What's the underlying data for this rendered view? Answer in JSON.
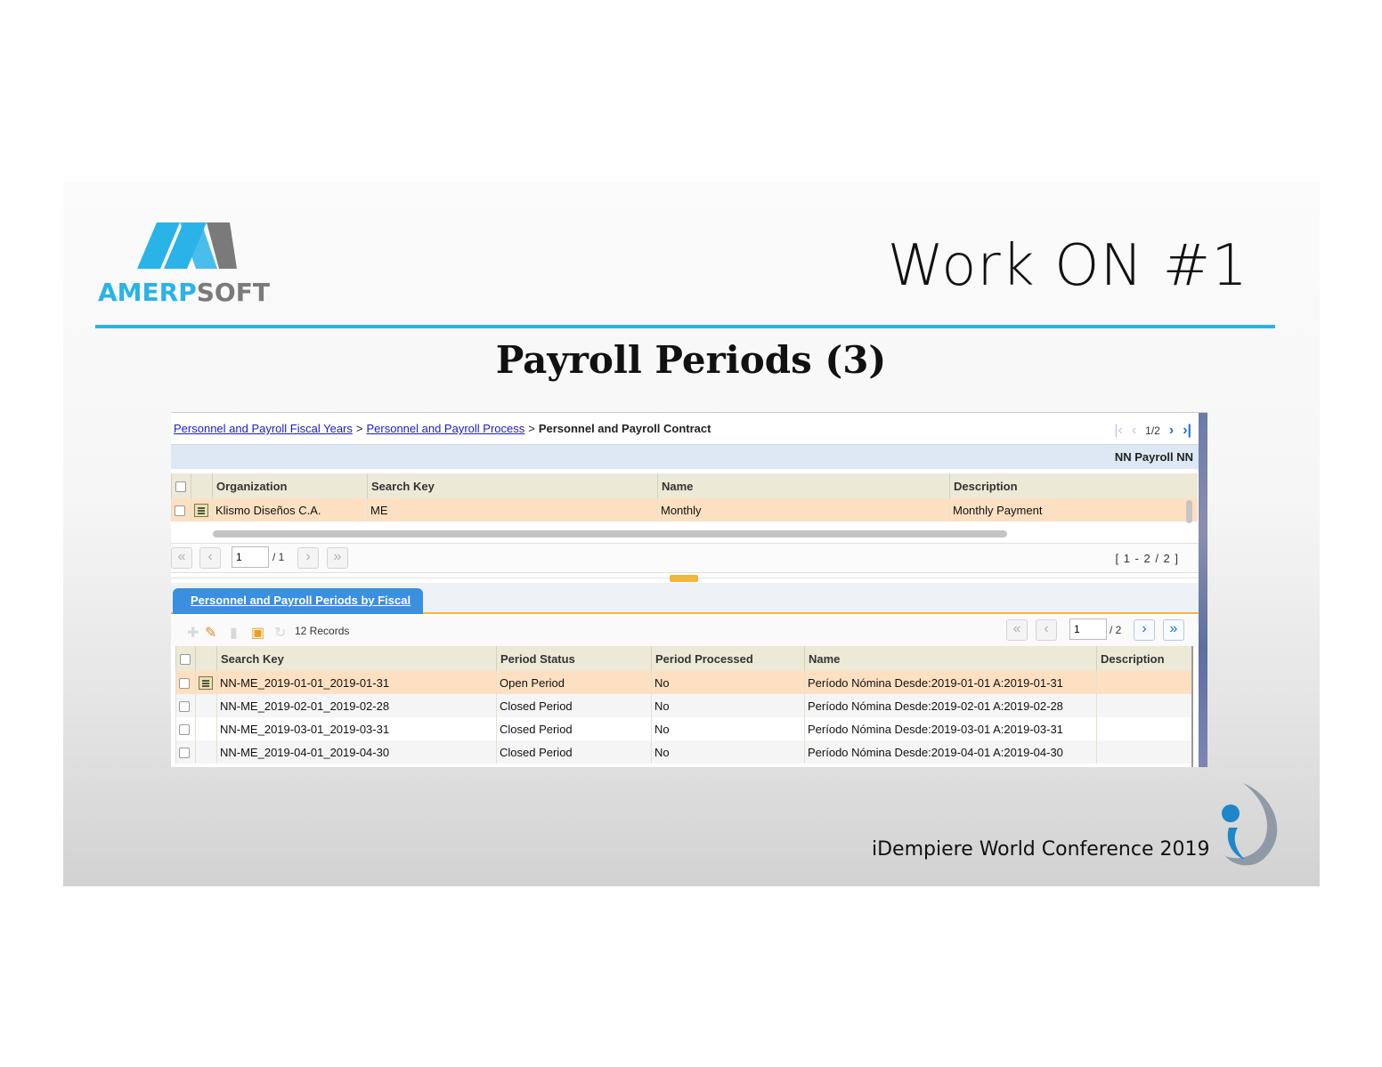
{
  "slide": {
    "title": "Work ON #1",
    "subtitle": "Payroll Periods (3)",
    "logo_text_a": "AMERP",
    "logo_text_b": "SOFT",
    "footer": "iDempiere World Conference 2019",
    "colors": {
      "accent": "#2ab3e6",
      "logo_gray": "#7a7a7a"
    }
  },
  "breadcrumb": {
    "link1": "Personnel and Payroll Fiscal Years",
    "link2": "Personnel and Payroll Process",
    "current": "Personnel and Payroll Contract",
    "sep": ">"
  },
  "record_nav": {
    "position": "1/2"
  },
  "header_band": {
    "label": "NN Payroll NN"
  },
  "parent_grid": {
    "columns": [
      "Organization",
      "Search Key",
      "Name",
      "Description"
    ],
    "rows": [
      [
        "Klismo Diseños C.A.",
        "ME",
        "Monthly",
        "Monthly Payment"
      ]
    ]
  },
  "parent_pager": {
    "page": "1",
    "total": "/ 1",
    "range": "[ 1 - 2 / 2 ]"
  },
  "tab": {
    "label": "Personnel and Payroll Periods by Fiscal"
  },
  "toolbar": {
    "records": "12 Records"
  },
  "child_pager": {
    "page": "1",
    "total": "/ 2"
  },
  "child_grid": {
    "columns": [
      "Search Key",
      "Period Status",
      "Period Processed",
      "Name",
      "Description"
    ],
    "rows": [
      [
        "NN-ME_2019-01-01_2019-01-31",
        "Open Period",
        "No",
        "Período Nómina Desde:2019-01-01 A:2019-01-31",
        ""
      ],
      [
        "NN-ME_2019-02-01_2019-02-28",
        "Closed Period",
        "No",
        "Período Nómina Desde:2019-02-01 A:2019-02-28",
        ""
      ],
      [
        "NN-ME_2019-03-01_2019-03-31",
        "Closed Period",
        "No",
        "Período Nómina Desde:2019-03-01 A:2019-03-31",
        ""
      ],
      [
        "NN-ME_2019-04-01_2019-04-30",
        "Closed Period",
        "No",
        "Período Nómina Desde:2019-04-01 A:2019-04-30",
        ""
      ]
    ]
  }
}
